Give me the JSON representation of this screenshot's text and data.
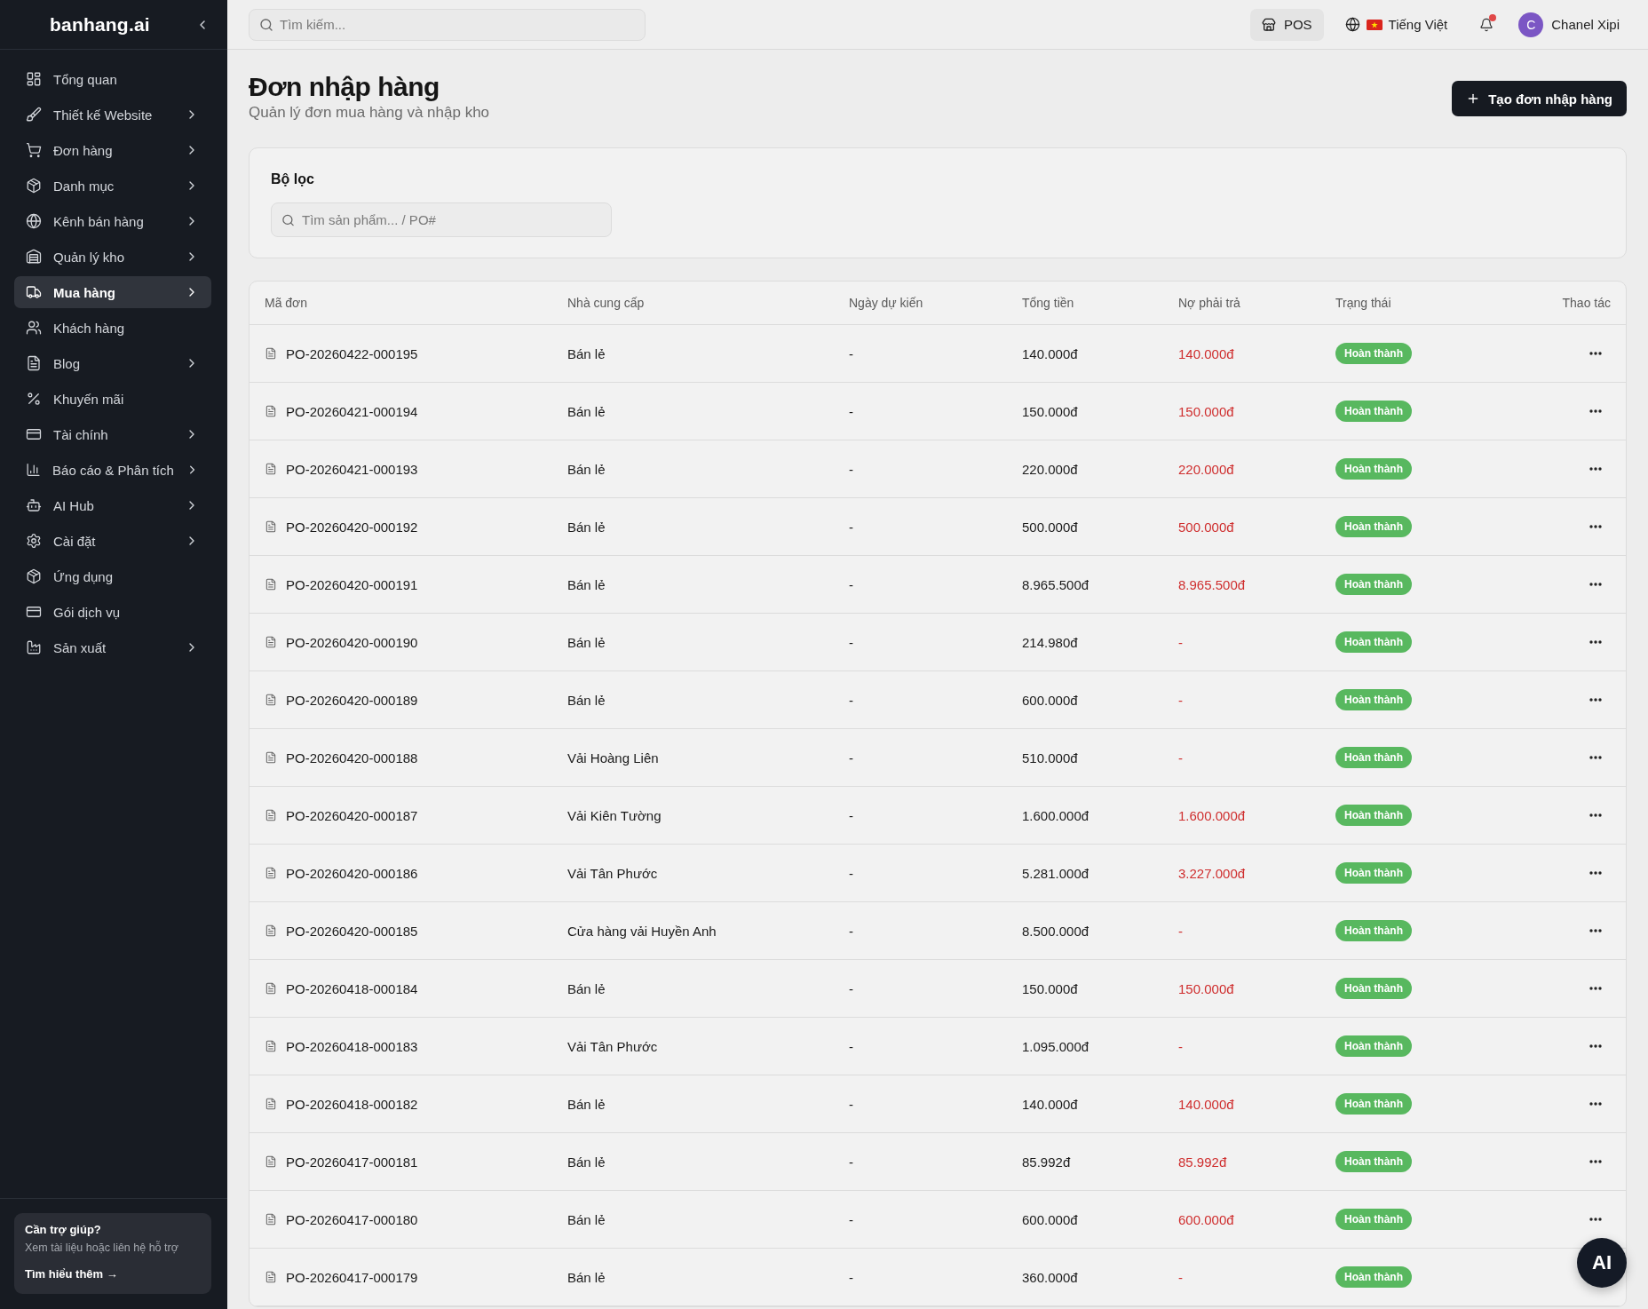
{
  "sidebar": {
    "logo": "banhang.ai",
    "items": [
      {
        "label": "Tổng quan",
        "expandable": false,
        "selected": false
      },
      {
        "label": "Thiết kế Website",
        "expandable": true,
        "selected": false
      },
      {
        "label": "Đơn hàng",
        "expandable": true,
        "selected": false
      },
      {
        "label": "Danh mục",
        "expandable": true,
        "selected": false
      },
      {
        "label": "Kênh bán hàng",
        "expandable": true,
        "selected": false
      },
      {
        "label": "Quản lý kho",
        "expandable": true,
        "selected": false
      },
      {
        "label": "Mua hàng",
        "expandable": true,
        "selected": true
      },
      {
        "label": "Khách hàng",
        "expandable": false,
        "selected": false
      },
      {
        "label": "Blog",
        "expandable": true,
        "selected": false
      },
      {
        "label": "Khuyến mãi",
        "expandable": false,
        "selected": false
      },
      {
        "label": "Tài chính",
        "expandable": true,
        "selected": false
      },
      {
        "label": "Báo cáo & Phân tích",
        "expandable": true,
        "selected": false
      },
      {
        "label": "AI Hub",
        "expandable": true,
        "selected": false
      },
      {
        "label": "Cài đặt",
        "expandable": true,
        "selected": false
      },
      {
        "label": "Ứng dụng",
        "expandable": false,
        "selected": false
      },
      {
        "label": "Gói dịch vụ",
        "expandable": false,
        "selected": false
      },
      {
        "label": "Sản xuất",
        "expandable": true,
        "selected": false
      }
    ],
    "help": {
      "title": "Cần trợ giúp?",
      "text": "Xem tài liệu hoặc liên hệ hỗ trợ",
      "link": "Tìm hiểu thêm →"
    }
  },
  "topbar": {
    "search": {
      "placeholder": "Tìm kiếm..."
    },
    "pos": "POS",
    "language": "Tiếng Việt",
    "notifications": {
      "unread": true
    },
    "user": {
      "initial": "C",
      "name": "Chanel Xipi"
    }
  },
  "header": {
    "title": "Đơn nhập hàng",
    "subtitle": "Quản lý đơn mua hàng và nhập kho",
    "create_button": "Tạo đơn nhập hàng"
  },
  "filter": {
    "title": "Bộ lọc",
    "search": {
      "placeholder": "Tìm sản phẩm... / PO#"
    }
  },
  "table": {
    "columns": [
      "Mã đơn",
      "Nhà cung cấp",
      "Ngày dự kiến",
      "Tổng tiền",
      "Nợ phải trả",
      "Trạng thái",
      "Thao tác"
    ],
    "rows": [
      {
        "code": "PO-20260422-000195",
        "supplier": "Bán lẻ",
        "expected_date": "-",
        "total": "140.000đ",
        "payable": "140.000đ",
        "status": {
          "label": "Hoàn thành",
          "kind": "completed"
        },
        "menu": true
      },
      {
        "code": "PO-20260421-000194",
        "supplier": "Bán lẻ",
        "expected_date": "-",
        "total": "150.000đ",
        "payable": "150.000đ",
        "status": {
          "label": "Hoàn thành",
          "kind": "completed"
        },
        "menu": true
      },
      {
        "code": "PO-20260421-000193",
        "supplier": "Bán lẻ",
        "expected_date": "-",
        "total": "220.000đ",
        "payable": "220.000đ",
        "status": {
          "label": "Hoàn thành",
          "kind": "completed"
        },
        "menu": true
      },
      {
        "code": "PO-20260420-000192",
        "supplier": "Bán lẻ",
        "expected_date": "-",
        "total": "500.000đ",
        "payable": "500.000đ",
        "status": {
          "label": "Hoàn thành",
          "kind": "completed"
        },
        "menu": true
      },
      {
        "code": "PO-20260420-000191",
        "supplier": "Bán lẻ",
        "expected_date": "-",
        "total": "8.965.500đ",
        "payable": "8.965.500đ",
        "status": {
          "label": "Hoàn thành",
          "kind": "completed"
        },
        "menu": true
      },
      {
        "code": "PO-20260420-000190",
        "supplier": "Bán lẻ",
        "expected_date": "-",
        "total": "214.980đ",
        "payable": "-",
        "status": {
          "label": "Hoàn thành",
          "kind": "completed"
        },
        "menu": true
      },
      {
        "code": "PO-20260420-000189",
        "supplier": "Bán lẻ",
        "expected_date": "-",
        "total": "600.000đ",
        "payable": "-",
        "status": {
          "label": "Hoàn thành",
          "kind": "completed"
        },
        "menu": true
      },
      {
        "code": "PO-20260420-000188",
        "supplier": "Vải Hoàng Liên",
        "expected_date": "-",
        "total": "510.000đ",
        "payable": "-",
        "status": {
          "label": "Hoàn thành",
          "kind": "completed"
        },
        "menu": true
      },
      {
        "code": "PO-20260420-000187",
        "supplier": "Vải Kiên Tường",
        "expected_date": "-",
        "total": "1.600.000đ",
        "payable": "1.600.000đ",
        "status": {
          "label": "Hoàn thành",
          "kind": "completed"
        },
        "menu": true
      },
      {
        "code": "PO-20260420-000186",
        "supplier": "Vải Tân Phước",
        "expected_date": "-",
        "total": "5.281.000đ",
        "payable": "3.227.000đ",
        "status": {
          "label": "Hoàn thành",
          "kind": "completed"
        },
        "menu": true
      },
      {
        "code": "PO-20260420-000185",
        "supplier": "Cửa hàng vải Huyền Anh",
        "expected_date": "-",
        "total": "8.500.000đ",
        "payable": "-",
        "status": {
          "label": "Hoàn thành",
          "kind": "completed"
        },
        "menu": true
      },
      {
        "code": "PO-20260418-000184",
        "supplier": "Bán lẻ",
        "expected_date": "-",
        "total": "150.000đ",
        "payable": "150.000đ",
        "status": {
          "label": "Hoàn thành",
          "kind": "completed"
        },
        "menu": true
      },
      {
        "code": "PO-20260418-000183",
        "supplier": "Vải Tân Phước",
        "expected_date": "-",
        "total": "1.095.000đ",
        "payable": "-",
        "status": {
          "label": "Hoàn thành",
          "kind": "completed"
        },
        "menu": true
      },
      {
        "code": "PO-20260418-000182",
        "supplier": "Bán lẻ",
        "expected_date": "-",
        "total": "140.000đ",
        "payable": "140.000đ",
        "status": {
          "label": "Hoàn thành",
          "kind": "completed"
        },
        "menu": true
      },
      {
        "code": "PO-20260417-000181",
        "supplier": "Bán lẻ",
        "expected_date": "-",
        "total": "85.992đ",
        "payable": "85.992đ",
        "status": {
          "label": "Hoàn thành",
          "kind": "completed"
        },
        "menu": true
      },
      {
        "code": "PO-20260417-000180",
        "supplier": "Bán lẻ",
        "expected_date": "-",
        "total": "600.000đ",
        "payable": "600.000đ",
        "status": {
          "label": "Hoàn thành",
          "kind": "completed"
        },
        "menu": true
      },
      {
        "code": "PO-20260417-000179",
        "supplier": "Bán lẻ",
        "expected_date": "-",
        "total": "360.000đ",
        "payable": "-",
        "status": {
          "label": "Hoàn thành",
          "kind": "completed"
        },
        "menu": false
      }
    ]
  },
  "ai_button": "AI"
}
